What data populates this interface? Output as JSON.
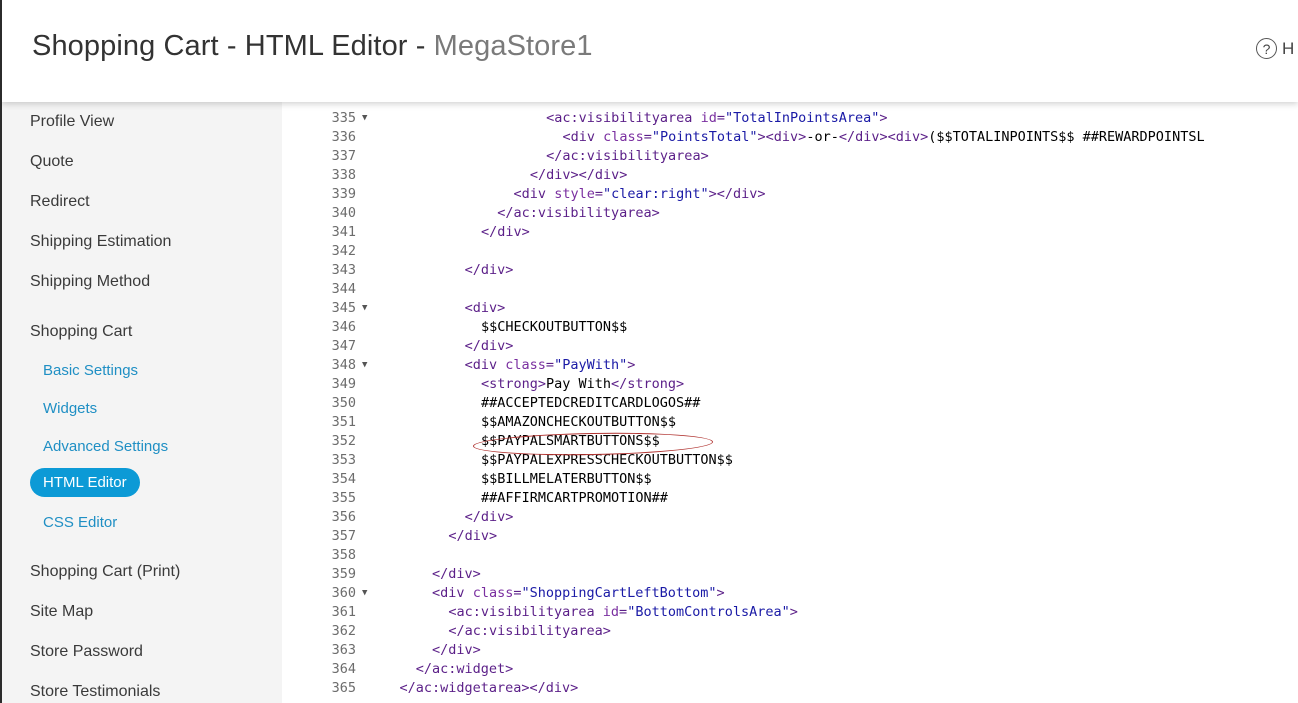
{
  "header": {
    "title": "Shopping Cart - HTML Editor - ",
    "store_name": "MegaStore1",
    "help_label": "H",
    "help_icon": "question-circle-icon"
  },
  "sidebar": {
    "items": [
      {
        "label": "Profile View",
        "type": "nav"
      },
      {
        "label": "Quote",
        "type": "nav"
      },
      {
        "label": "Redirect",
        "type": "nav"
      },
      {
        "label": "Shipping Estimation",
        "type": "nav"
      },
      {
        "label": "Shipping Method",
        "type": "nav"
      },
      {
        "label": "Shopping Cart",
        "type": "nav"
      },
      {
        "label": "Basic Settings",
        "type": "sub"
      },
      {
        "label": "Widgets",
        "type": "sub"
      },
      {
        "label": "Advanced Settings",
        "type": "sub"
      },
      {
        "label": "HTML Editor",
        "type": "sub",
        "active": true
      },
      {
        "label": "CSS Editor",
        "type": "sub"
      },
      {
        "label": "Shopping Cart (Print)",
        "type": "nav"
      },
      {
        "label": "Site Map",
        "type": "nav"
      },
      {
        "label": "Store Password",
        "type": "nav"
      },
      {
        "label": "Store Testimonials",
        "type": "nav"
      }
    ]
  },
  "editor": {
    "highlight_line": "352",
    "lines": [
      {
        "n": "335",
        "fold": true,
        "indent": 21,
        "segs": [
          [
            "tag",
            "<ac:visibilityarea "
          ],
          [
            "attr",
            "id"
          ],
          [
            "tag",
            "="
          ],
          [
            "val",
            "\"TotalInPointsArea\""
          ],
          [
            "tag",
            ">"
          ]
        ]
      },
      {
        "n": "336",
        "fold": false,
        "indent": 23,
        "segs": [
          [
            "tag",
            "<div "
          ],
          [
            "attr",
            "class"
          ],
          [
            "tag",
            "="
          ],
          [
            "val",
            "\"PointsTotal\""
          ],
          [
            "tag",
            "><div>"
          ],
          [
            "txt",
            "-or-"
          ],
          [
            "tag",
            "</div><div>"
          ],
          [
            "txt",
            "($$TOTALINPOINTS$$ ##REWARDPOINTSL"
          ]
        ]
      },
      {
        "n": "337",
        "fold": false,
        "indent": 21,
        "segs": [
          [
            "tag",
            "</ac:visibilityarea>"
          ]
        ]
      },
      {
        "n": "338",
        "fold": false,
        "indent": 19,
        "segs": [
          [
            "tag",
            "</div></div>"
          ]
        ]
      },
      {
        "n": "339",
        "fold": false,
        "indent": 17,
        "segs": [
          [
            "tag",
            "<div "
          ],
          [
            "attr",
            "style"
          ],
          [
            "tag",
            "="
          ],
          [
            "val",
            "\"clear:right\""
          ],
          [
            "tag",
            "></div>"
          ]
        ]
      },
      {
        "n": "340",
        "fold": false,
        "indent": 15,
        "segs": [
          [
            "tag",
            "</ac:visibilityarea>"
          ]
        ]
      },
      {
        "n": "341",
        "fold": false,
        "indent": 13,
        "segs": [
          [
            "tag",
            "</div>"
          ]
        ]
      },
      {
        "n": "342",
        "fold": false,
        "indent": 0,
        "segs": []
      },
      {
        "n": "343",
        "fold": false,
        "indent": 11,
        "segs": [
          [
            "tag",
            "</div>"
          ]
        ]
      },
      {
        "n": "344",
        "fold": false,
        "indent": 0,
        "segs": []
      },
      {
        "n": "345",
        "fold": true,
        "indent": 11,
        "segs": [
          [
            "tag",
            "<div>"
          ]
        ]
      },
      {
        "n": "346",
        "fold": false,
        "indent": 13,
        "segs": [
          [
            "txt",
            "$$CHECKOUTBUTTON$$"
          ]
        ]
      },
      {
        "n": "347",
        "fold": false,
        "indent": 11,
        "segs": [
          [
            "tag",
            "</div>"
          ]
        ]
      },
      {
        "n": "348",
        "fold": true,
        "indent": 11,
        "segs": [
          [
            "tag",
            "<div "
          ],
          [
            "attr",
            "class"
          ],
          [
            "tag",
            "="
          ],
          [
            "val",
            "\"PayWith\""
          ],
          [
            "tag",
            ">"
          ]
        ]
      },
      {
        "n": "349",
        "fold": false,
        "indent": 13,
        "segs": [
          [
            "tag",
            "<strong>"
          ],
          [
            "txt",
            "Pay With"
          ],
          [
            "tag",
            "</strong>"
          ]
        ]
      },
      {
        "n": "350",
        "fold": false,
        "indent": 13,
        "segs": [
          [
            "txt",
            "##ACCEPTEDCREDITCARDLOGOS##"
          ]
        ]
      },
      {
        "n": "351",
        "fold": false,
        "indent": 13,
        "segs": [
          [
            "txt",
            "$$AMAZONCHECKOUTBUTTON$$"
          ]
        ]
      },
      {
        "n": "352",
        "fold": false,
        "indent": 13,
        "segs": [
          [
            "txt",
            "$$PAYPALSMARTBUTTONS$$"
          ]
        ]
      },
      {
        "n": "353",
        "fold": false,
        "indent": 13,
        "segs": [
          [
            "txt",
            "$$PAYPALEXPRESSCHECKOUTBUTTON$$"
          ]
        ]
      },
      {
        "n": "354",
        "fold": false,
        "indent": 13,
        "segs": [
          [
            "txt",
            "$$BILLMELATERBUTTON$$"
          ]
        ]
      },
      {
        "n": "355",
        "fold": false,
        "indent": 13,
        "segs": [
          [
            "txt",
            "##AFFIRMCARTPROMOTION##"
          ]
        ]
      },
      {
        "n": "356",
        "fold": false,
        "indent": 11,
        "segs": [
          [
            "tag",
            "</div>"
          ]
        ]
      },
      {
        "n": "357",
        "fold": false,
        "indent": 9,
        "segs": [
          [
            "tag",
            "</div>"
          ]
        ]
      },
      {
        "n": "358",
        "fold": false,
        "indent": 0,
        "segs": []
      },
      {
        "n": "359",
        "fold": false,
        "indent": 7,
        "segs": [
          [
            "tag",
            "</div>"
          ]
        ]
      },
      {
        "n": "360",
        "fold": true,
        "indent": 7,
        "segs": [
          [
            "tag",
            "<div "
          ],
          [
            "attr",
            "class"
          ],
          [
            "tag",
            "="
          ],
          [
            "val",
            "\"ShoppingCartLeftBottom\""
          ],
          [
            "tag",
            ">"
          ]
        ]
      },
      {
        "n": "361",
        "fold": false,
        "indent": 9,
        "segs": [
          [
            "tag",
            "<ac:visibilityarea "
          ],
          [
            "attr",
            "id"
          ],
          [
            "tag",
            "="
          ],
          [
            "val",
            "\"BottomControlsArea\""
          ],
          [
            "tag",
            ">"
          ]
        ]
      },
      {
        "n": "362",
        "fold": false,
        "indent": 9,
        "segs": [
          [
            "tag",
            "</ac:visibilityarea>"
          ]
        ]
      },
      {
        "n": "363",
        "fold": false,
        "indent": 7,
        "segs": [
          [
            "tag",
            "</div>"
          ]
        ]
      },
      {
        "n": "364",
        "fold": false,
        "indent": 5,
        "segs": [
          [
            "tag",
            "</ac:widget>"
          ]
        ]
      },
      {
        "n": "365",
        "fold": false,
        "indent": 3,
        "segs": [
          [
            "tag",
            "</ac:widgetarea></div>"
          ]
        ]
      }
    ]
  }
}
